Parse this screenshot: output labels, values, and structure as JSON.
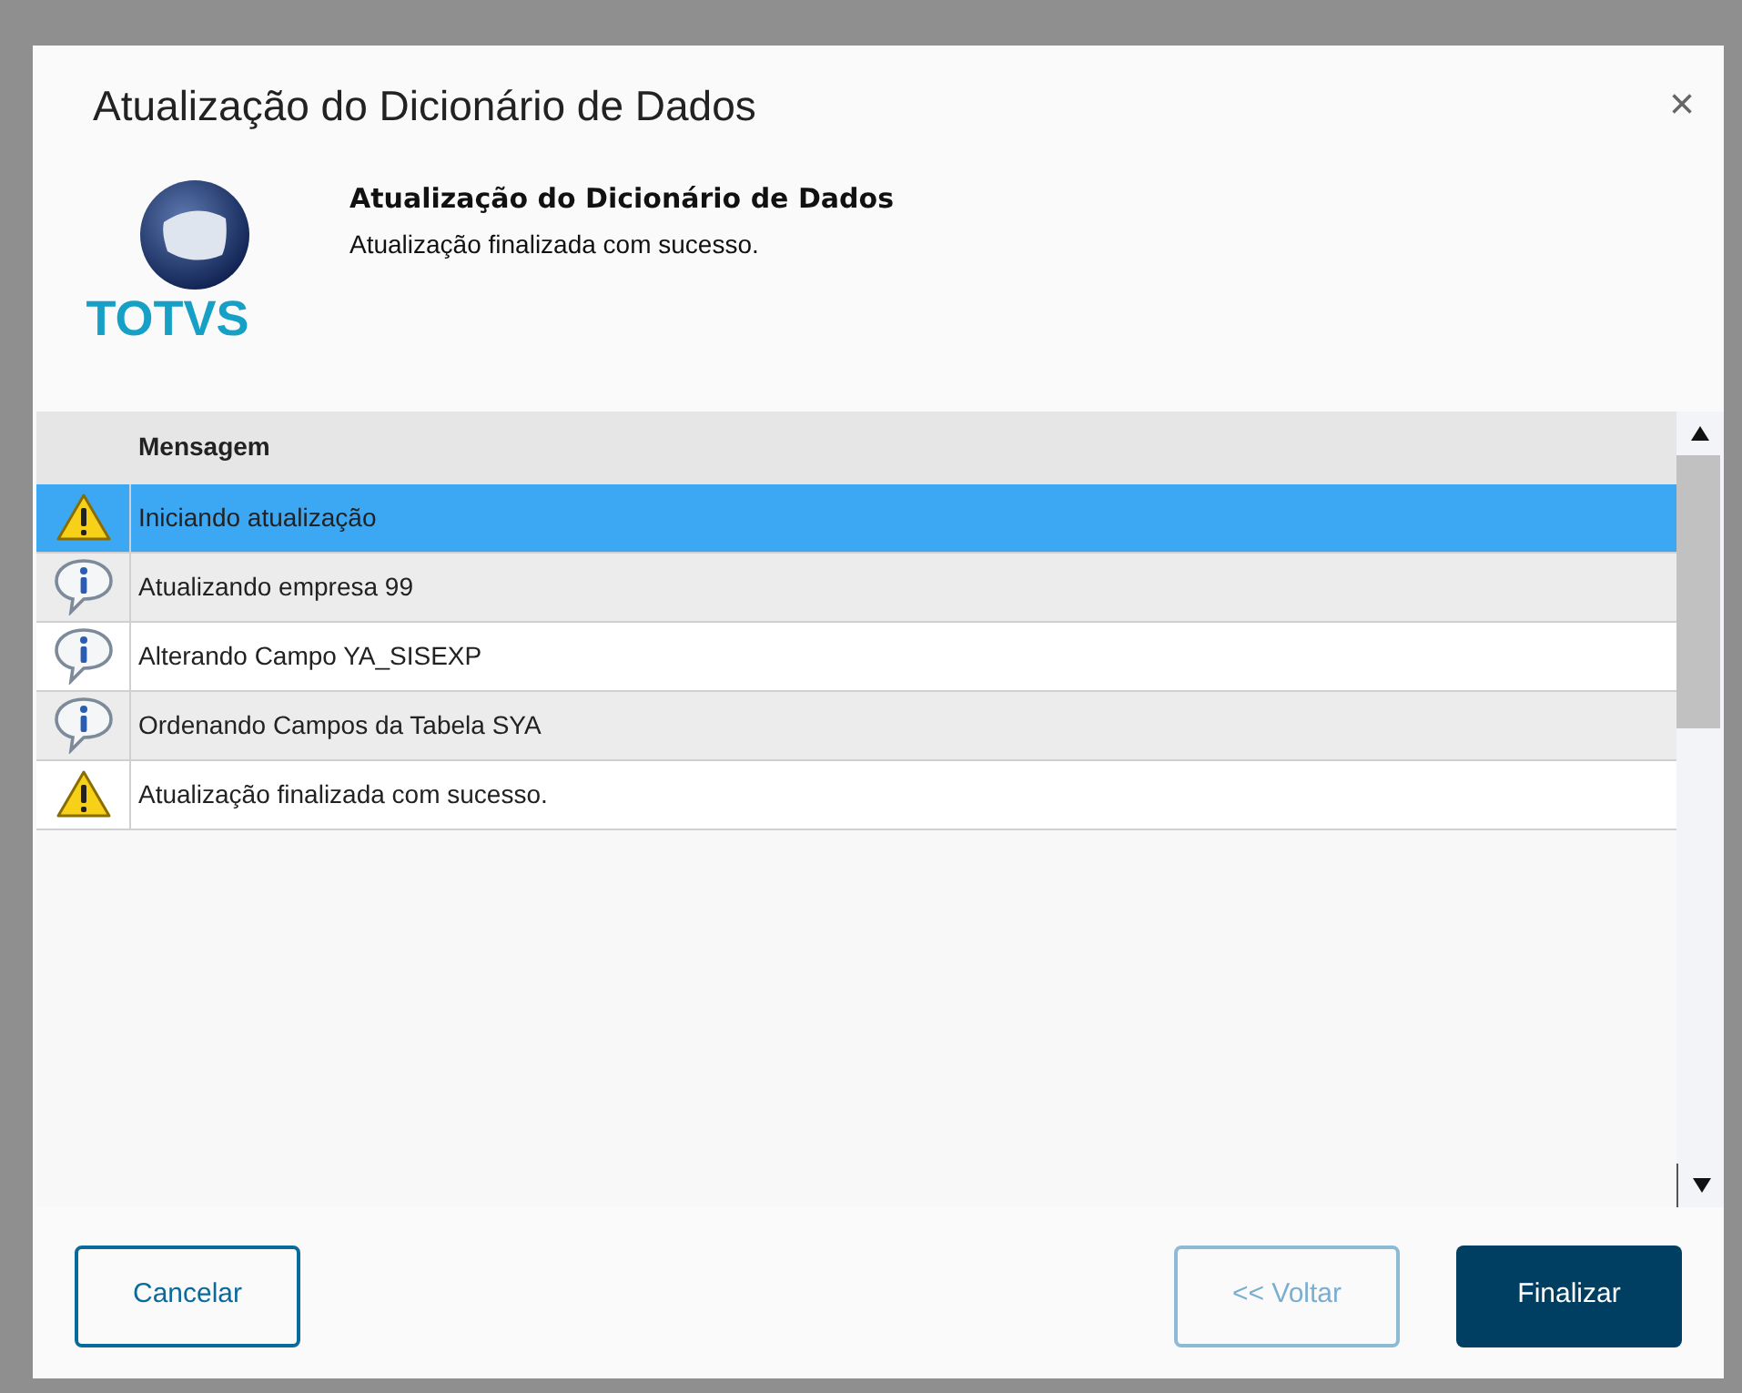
{
  "dialog": {
    "title": "Atualização do Dicionário de Dados",
    "close": "×"
  },
  "header": {
    "logo_text": "TOTVS",
    "title": "Atualização do Dicionário de Dados",
    "subtitle": "Atualização finalizada com sucesso."
  },
  "table": {
    "columns": [
      "Mensagem"
    ],
    "rows": [
      {
        "kind": "warning",
        "message": "Iniciando atualização",
        "selected": true
      },
      {
        "kind": "info",
        "message": "Atualizando empresa 99",
        "selected": false
      },
      {
        "kind": "info",
        "message": "Alterando Campo YA_SISEXP",
        "selected": false
      },
      {
        "kind": "info",
        "message": "Ordenando Campos da Tabela SYA",
        "selected": false
      },
      {
        "kind": "warning",
        "message": "Atualização finalizada com sucesso.",
        "selected": false
      }
    ]
  },
  "buttons": [
    {
      "label": "Cancelar",
      "kind": "outline",
      "disabled": false
    },
    {
      "label": "<< Voltar",
      "kind": "outline",
      "disabled": true
    },
    {
      "label": "Finalizar",
      "kind": "primary",
      "disabled": false
    }
  ]
}
